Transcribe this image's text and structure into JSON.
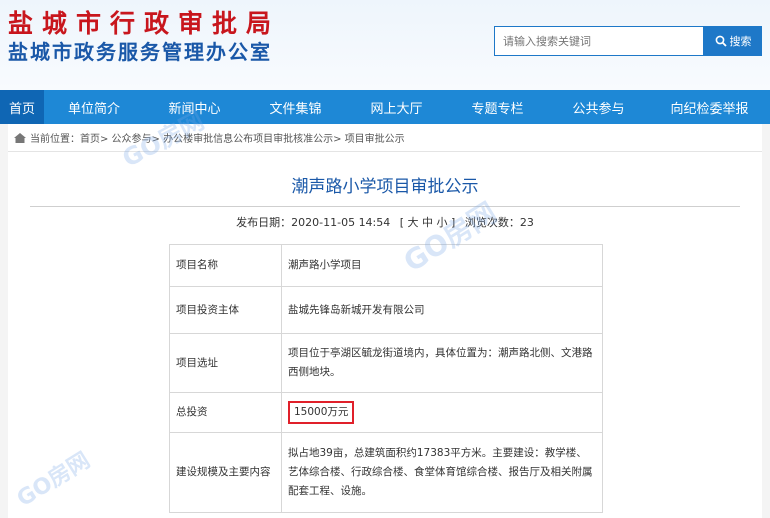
{
  "header": {
    "title": "盐城市行政审批局",
    "subtitle": "盐城市政务服务管理办公室",
    "search_placeholder": "请输入搜索关键词",
    "search_button": "搜索"
  },
  "nav": [
    {
      "label": "首页",
      "active": true
    },
    {
      "label": "单位简介"
    },
    {
      "label": "新闻中心"
    },
    {
      "label": "文件集锦"
    },
    {
      "label": "网上大厅"
    },
    {
      "label": "专题专栏"
    },
    {
      "label": "公共参与"
    },
    {
      "label": "向纪检委举报"
    }
  ],
  "breadcrumb": "当前位置：首页> 公众参与> 办公楼审批信息公布项目审批核准公示> 项目审批公示",
  "article": {
    "title": "潮声路小学项目审批公示",
    "publish_label": "发布日期：2020-11-05 14:54",
    "font_size_label": "[ 大 中 小 ]",
    "views_label": "浏览次数：23"
  },
  "table": [
    {
      "label": "项目名称",
      "value": "潮声路小学项目"
    },
    {
      "label": "项目投资主体",
      "value": "盐城先锋岛新城开发有限公司"
    },
    {
      "label": "项目选址",
      "value": "项目位于亭湖区毓龙街道境内，具体位置为：潮声路北侧、文港路西侧地块。"
    },
    {
      "label": "总投资",
      "value": "15000万元",
      "highlight": true
    },
    {
      "label": "建设规模及主要内容",
      "value": "拟占地39亩，总建筑面积约17383平方米。主要建设：教学楼、艺体综合楼、行政综合楼、食堂体育馆综合楼、报告厅及相关附属配套工程、设施。"
    }
  ],
  "watermarks": [
    "GO房网",
    "GO房网",
    "GO房网"
  ],
  "colors": {
    "nav_bg": "#1e88d6",
    "nav_active": "#0f66b4",
    "title_red": "#c8161d",
    "brand_blue": "#1a58a8",
    "highlight_red": "#e0202a"
  }
}
